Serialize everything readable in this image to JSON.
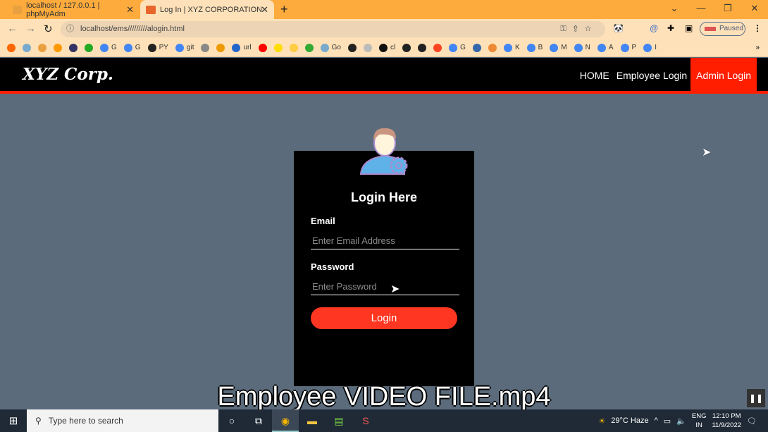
{
  "browser": {
    "tabs": [
      {
        "title": "localhost / 127.0.0.1 | phpMyAdm",
        "active": false
      },
      {
        "title": "Log In | XYZ CORPORATION",
        "active": true
      }
    ],
    "url": "localhost/ems/////////alogin.html",
    "profile_status": "Paused",
    "bookmarks": [
      "",
      "",
      "",
      "",
      "",
      "",
      "G",
      "G",
      "PY",
      "git",
      "",
      "",
      "url",
      "",
      "",
      "",
      "",
      "Go",
      "",
      "",
      "cl",
      "",
      "",
      "",
      "G",
      "",
      "",
      "K",
      "B",
      "M",
      "N",
      "A",
      "P",
      "I"
    ]
  },
  "site": {
    "logo": "XYZ Corp.",
    "nav": [
      {
        "label": "HOME"
      },
      {
        "label": "Employee Login"
      },
      {
        "label": "Admin Login",
        "active": true
      }
    ],
    "accent": "#ff1e00"
  },
  "login": {
    "title": "Login Here",
    "email_label": "Email",
    "email_placeholder": "Enter Email Address",
    "password_label": "Password",
    "password_placeholder": "Enter Password",
    "button": "Login"
  },
  "video": {
    "caption": "Employee VIDEO FILE.mp4"
  },
  "taskbar": {
    "search_placeholder": "Type here to search",
    "weather": "29°C  Haze",
    "lang1": "ENG",
    "lang2": "IN",
    "time": "12:10 PM",
    "date": "11/9/2022"
  }
}
